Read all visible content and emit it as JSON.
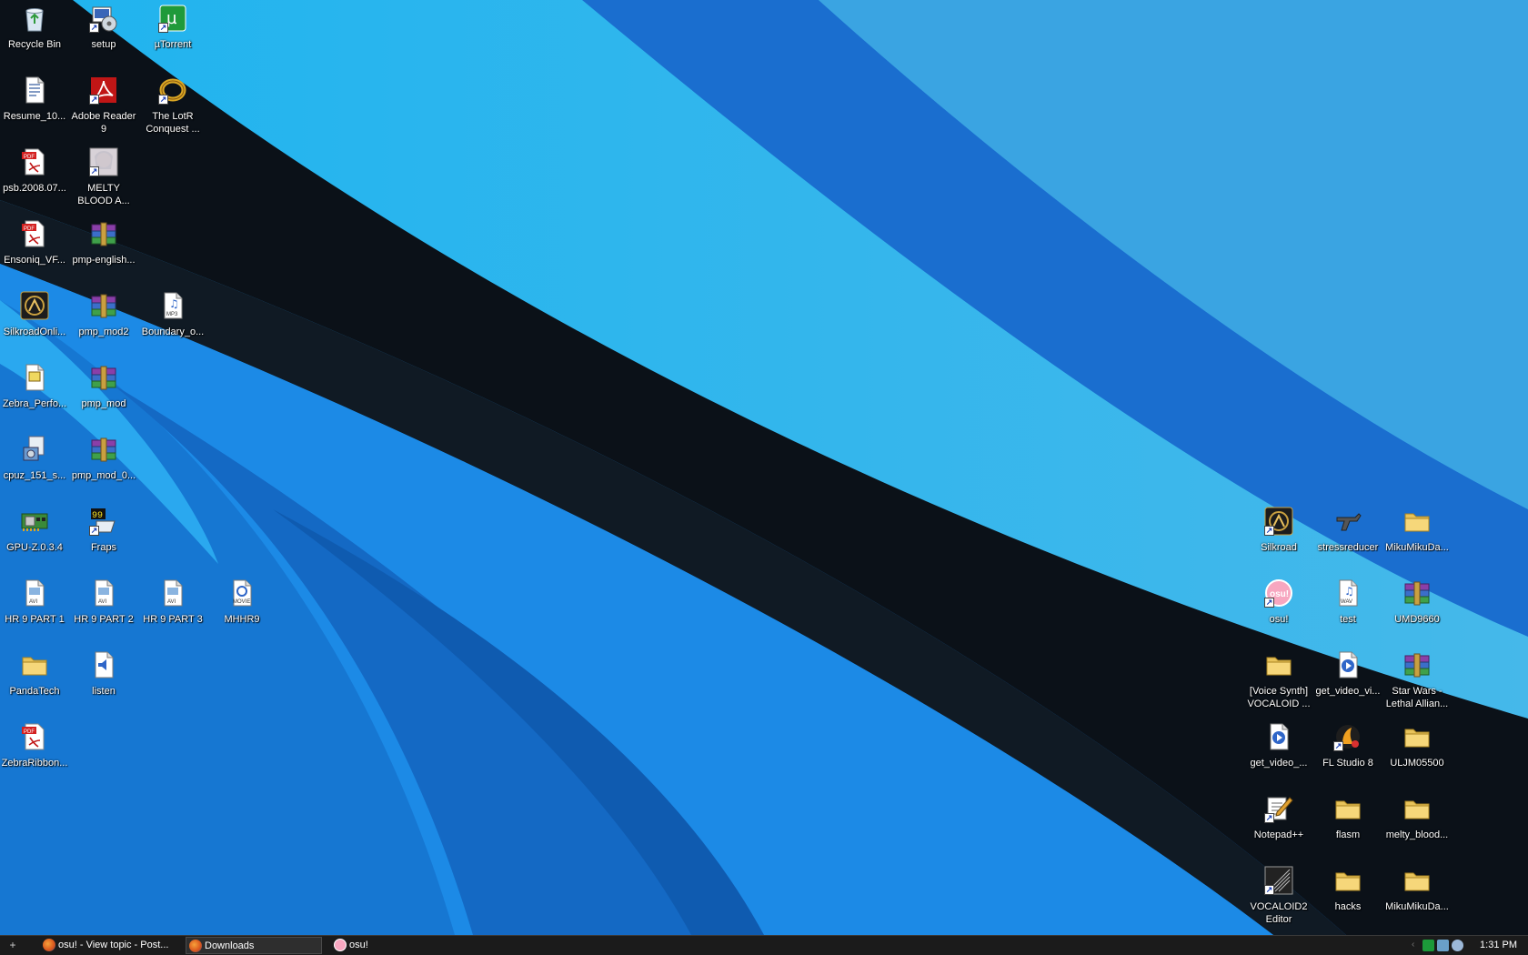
{
  "desktop": {
    "left_icons": [
      {
        "label": "Recycle Bin",
        "icon": "recycle-bin-icon",
        "shortcut": false
      },
      {
        "label": "setup",
        "icon": "setup-icon",
        "shortcut": true
      },
      {
        "label": "µTorrent",
        "icon": "utorrent-icon",
        "shortcut": true
      },
      {
        "label": "Resume_10...",
        "icon": "document-icon",
        "shortcut": false
      },
      {
        "label": "Adobe Reader\n9",
        "icon": "adobe-reader-icon",
        "shortcut": true
      },
      {
        "label": "The LotR\nConquest ...",
        "icon": "ring-icon",
        "shortcut": true
      },
      {
        "label": "psb.2008.07...",
        "icon": "pdf-icon",
        "shortcut": false
      },
      {
        "label": "MELTY\nBLOOD A...",
        "icon": "anime-icon",
        "shortcut": true
      },
      {
        "label": "Ensoniq_VF...",
        "icon": "pdf-icon",
        "shortcut": false
      },
      {
        "label": "pmp-english...",
        "icon": "rar-archive-icon",
        "shortcut": false
      },
      {
        "label": "SilkroadOnli...",
        "icon": "silkroad-icon",
        "shortcut": false
      },
      {
        "label": "pmp_mod2",
        "icon": "rar-archive-icon",
        "shortcut": false
      },
      {
        "label": "Boundary_o...",
        "icon": "mp3-icon",
        "shortcut": false
      },
      {
        "label": "Zebra_Perfo...",
        "icon": "text-document-icon",
        "shortcut": false
      },
      {
        "label": "pmp_mod",
        "icon": "rar-archive-icon",
        "shortcut": false
      },
      {
        "label": "cpuz_151_s...",
        "icon": "installer-icon",
        "shortcut": false
      },
      {
        "label": "pmp_mod_0...",
        "icon": "rar-archive-icon",
        "shortcut": false
      },
      {
        "label": "GPU-Z.0.3.4",
        "icon": "graphics-card-icon",
        "shortcut": false
      },
      {
        "label": "Fraps",
        "icon": "fraps-icon",
        "shortcut": true
      },
      {
        "label": "HR 9 PART 1",
        "icon": "avi-icon",
        "shortcut": false
      },
      {
        "label": "HR 9 PART 2",
        "icon": "avi-icon",
        "shortcut": false
      },
      {
        "label": "HR 9 PART 3",
        "icon": "avi-icon",
        "shortcut": false
      },
      {
        "label": "MHHR9",
        "icon": "movie-icon",
        "shortcut": false
      },
      {
        "label": "PandaTech",
        "icon": "folder-icon",
        "shortcut": false
      },
      {
        "label": "listen",
        "icon": "audio-document-icon",
        "shortcut": false
      },
      {
        "label": "ZebraRibbon...",
        "icon": "pdf-icon",
        "shortcut": false
      }
    ],
    "right_icons": [
      {
        "label": "Silkroad",
        "icon": "silkroad-icon",
        "shortcut": true
      },
      {
        "label": "stressreducer",
        "icon": "gun-icon",
        "shortcut": false
      },
      {
        "label": "MikuMikuDa...",
        "icon": "folder-icon",
        "shortcut": false
      },
      {
        "label": "osu!",
        "icon": "osu-icon",
        "shortcut": true
      },
      {
        "label": "test",
        "icon": "wav-icon",
        "shortcut": false
      },
      {
        "label": "UMD9660",
        "icon": "rar-archive-icon",
        "shortcut": false
      },
      {
        "label": "[Voice Synth]\nVOCALOID ...",
        "icon": "folder-icon",
        "shortcut": false
      },
      {
        "label": "get_video_vi...",
        "icon": "media-file-icon",
        "shortcut": false
      },
      {
        "label": "Star Wars -\nLethal Allian...",
        "icon": "rar-archive-icon",
        "shortcut": false
      },
      {
        "label": "get_video_...",
        "icon": "media-file-icon",
        "shortcut": false
      },
      {
        "label": "FL Studio 8",
        "icon": "fl-studio-icon",
        "shortcut": true
      },
      {
        "label": "ULJM05500",
        "icon": "folder-icon",
        "shortcut": false
      },
      {
        "label": "Notepad++",
        "icon": "notepad-icon",
        "shortcut": true
      },
      {
        "label": "flasm",
        "icon": "folder-icon",
        "shortcut": false
      },
      {
        "label": "melty_blood...",
        "icon": "folder-icon",
        "shortcut": false
      },
      {
        "label": "VOCALOID2\nEditor",
        "icon": "vocaloid-icon",
        "shortcut": true
      },
      {
        "label": "hacks",
        "icon": "folder-icon",
        "shortcut": false
      },
      {
        "label": "MikuMikuDa...",
        "icon": "folder-icon",
        "shortcut": false
      }
    ]
  },
  "taskbar": {
    "start_glyph": "+",
    "tasks": [
      {
        "label": "osu! - View topic - Post...",
        "icon": "firefox-icon",
        "active": false
      },
      {
        "label": "Downloads",
        "icon": "firefox-icon",
        "active": true
      },
      {
        "label": "osu!",
        "icon": "osu-icon",
        "active": false
      }
    ],
    "tray_icons": [
      "utorrent-tray-icon",
      "network-tray-icon",
      "volume-tray-icon"
    ],
    "clock": "1:31 PM"
  },
  "colors": {
    "wallpaper_base": "#1e88e5",
    "wallpaper_light": "#29b6ef",
    "wallpaper_dark": "#0d47a1",
    "wallpaper_black": "#0a0f14",
    "taskbar": "#1b1b1b"
  }
}
